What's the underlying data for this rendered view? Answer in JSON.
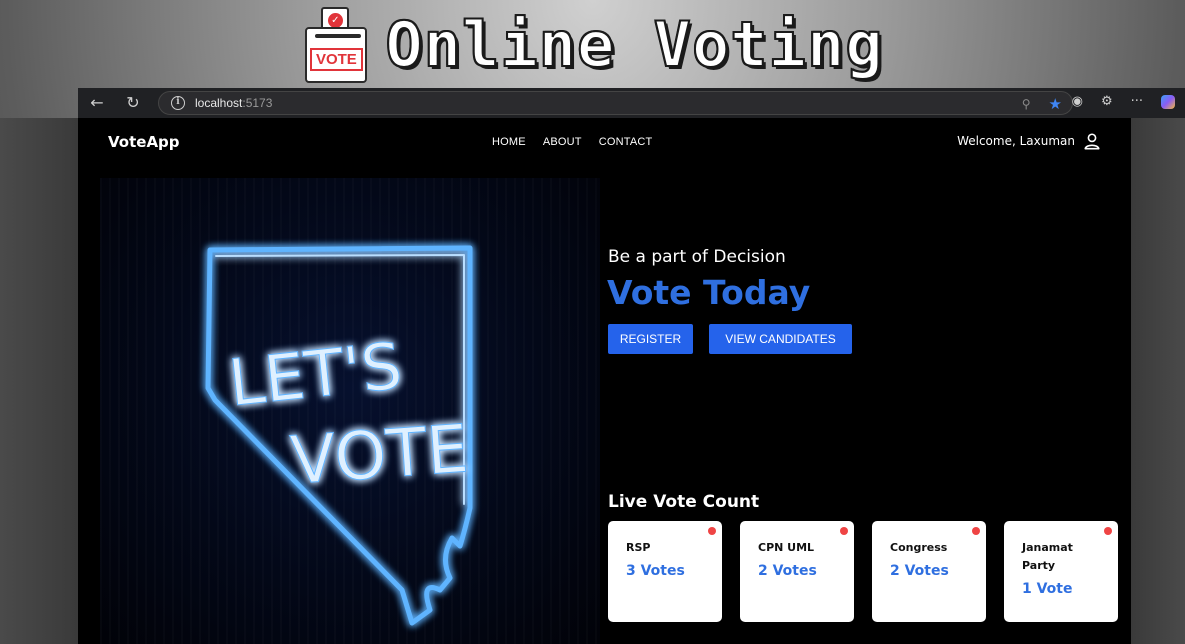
{
  "banner": {
    "title": "Online Voting",
    "ballot_label": "VOTE",
    "icon": "ballot-box-icon"
  },
  "browser": {
    "url_host": "localhost",
    "url_port": ":5173",
    "icons": [
      "back-arrow-icon",
      "reload-icon",
      "site-info-icon",
      "zoom-icon",
      "star-icon",
      "tracking-icon",
      "extensions-icon",
      "more-icon",
      "copilot-icon"
    ],
    "more_label": "···"
  },
  "app": {
    "brand": "VoteApp",
    "nav": [
      {
        "label": "HOME"
      },
      {
        "label": "ABOUT"
      },
      {
        "label": "CONTACT"
      }
    ],
    "welcome": "Welcome, Laxuman",
    "user_icon": "user-icon"
  },
  "hero": {
    "image_alt": "LET'S VOTE neon sign",
    "neon_line1": "LET'S",
    "neon_line2": "VOTE",
    "subtitle": "Be a part of Decision",
    "title": "Vote Today",
    "register_label": "REGISTER",
    "candidates_label": "VIEW CANDIDATES"
  },
  "live_count": {
    "title": "Live Vote Count",
    "parties": [
      {
        "name": "RSP",
        "votes": "3 Votes"
      },
      {
        "name": "CPN UML",
        "votes": "2 Votes"
      },
      {
        "name": "Congress",
        "votes": "2 Votes"
      },
      {
        "name": "Janamat Party",
        "votes": "1 Vote"
      }
    ],
    "dot_color": "#ef4444"
  },
  "colors": {
    "accent": "#2563eb",
    "title_blue": "#2f6fe0",
    "neon": "#4aa8ff",
    "background": "#000000"
  }
}
